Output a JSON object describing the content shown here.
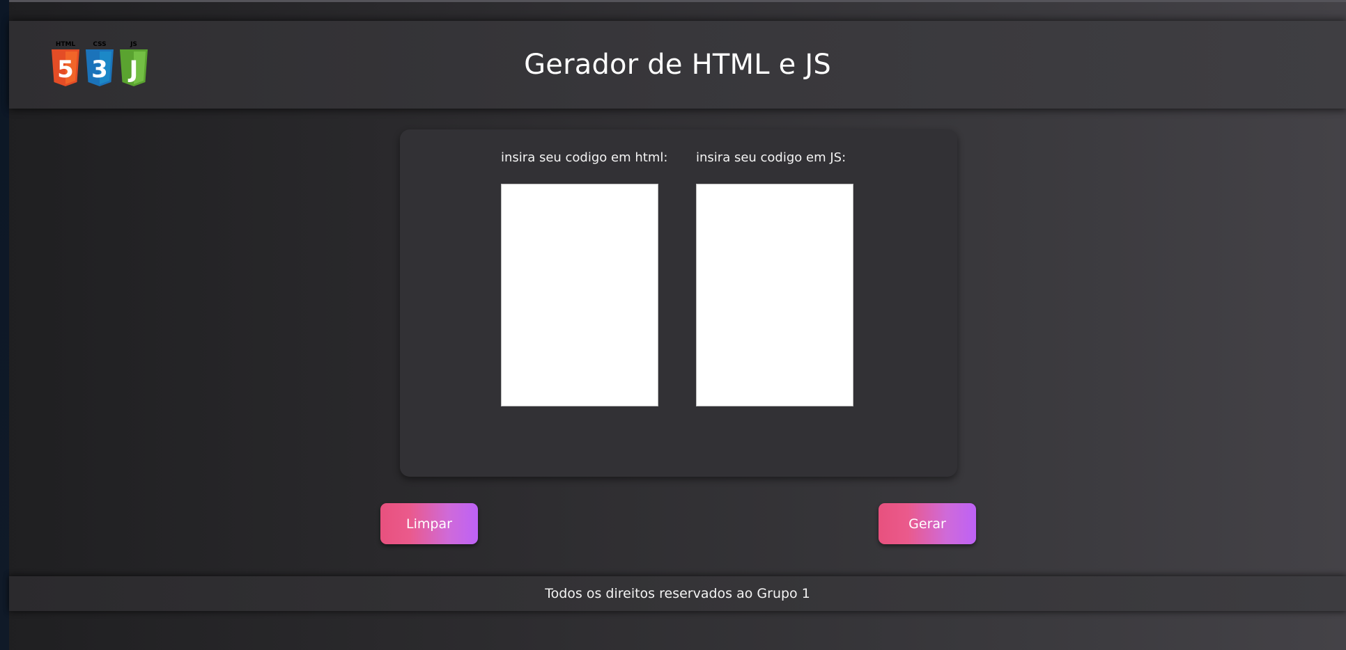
{
  "header": {
    "title": "Gerador de HTML e JS",
    "logo": {
      "badges": [
        "HTML",
        "CSS",
        "JS"
      ],
      "glyphs": [
        "5",
        "3",
        "J"
      ],
      "colors": [
        "#e44d26",
        "#1b73ba",
        "#5aa330"
      ]
    }
  },
  "editor": {
    "html_label": "insira seu codigo em html:",
    "js_label": "insira seu codigo em JS:",
    "html_value": "",
    "js_value": ""
  },
  "actions": {
    "clear_label": "Limpar",
    "generate_label": "Gerar"
  },
  "footer": {
    "text": "Todos os direitos reservados ao Grupo 1"
  },
  "colors": {
    "button_gradient_start": "#e8517e",
    "button_gradient_end": "#bd62f6",
    "panel": "#323135",
    "textarea_bg": "#ffffff"
  }
}
